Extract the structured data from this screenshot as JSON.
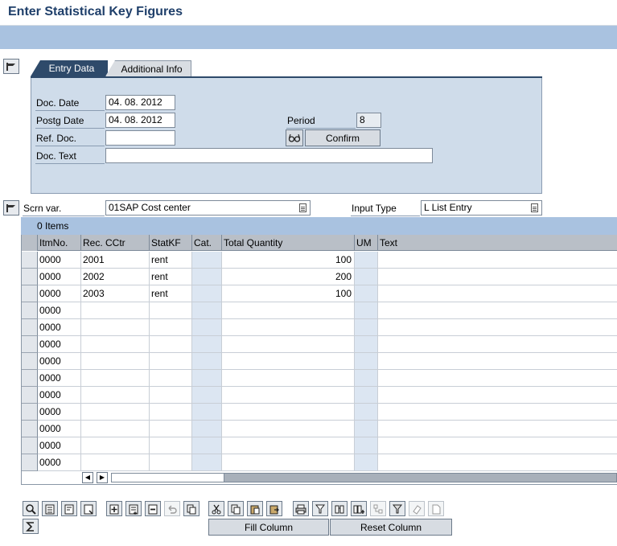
{
  "header": {
    "title": "Enter Statistical Key Figures"
  },
  "tabs": [
    {
      "label": "Entry Data",
      "active": true
    },
    {
      "label": "Additional Info",
      "active": false
    }
  ],
  "entry": {
    "doc_date_label": "Doc. Date",
    "doc_date_value": "04. 08. 2012",
    "postg_date_label": "Postg Date",
    "postg_date_value": "04. 08. 2012",
    "ref_doc_label": "Ref. Doc.",
    "ref_doc_value": "",
    "doc_text_label": "Doc. Text",
    "doc_text_value": "",
    "period_label": "Period",
    "period_value": "8",
    "confirm_label": "Confirm"
  },
  "screen": {
    "scrn_var_label": "Scrn var.",
    "scrn_var_value": "01SAP Cost center",
    "input_type_label": "Input Type",
    "input_type_value": "L List Entry"
  },
  "table": {
    "title": "0 Items",
    "columns": [
      "ItmNo.",
      "Rec. CCtr",
      "StatKF",
      "Cat.",
      "Total Quantity",
      "UM",
      "Text"
    ],
    "rows": [
      {
        "itm": "0000",
        "rec": "2001",
        "statkf": "rent",
        "cat": "",
        "qty": "100",
        "um": "",
        "text": ""
      },
      {
        "itm": "0000",
        "rec": "2002",
        "statkf": "rent",
        "cat": "",
        "qty": "200",
        "um": "",
        "text": ""
      },
      {
        "itm": "0000",
        "rec": "2003",
        "statkf": "rent",
        "cat": "",
        "qty": "100",
        "um": "",
        "text": ""
      },
      {
        "itm": "0000",
        "rec": "",
        "statkf": "",
        "cat": "",
        "qty": "",
        "um": "",
        "text": ""
      },
      {
        "itm": "0000",
        "rec": "",
        "statkf": "",
        "cat": "",
        "qty": "",
        "um": "",
        "text": ""
      },
      {
        "itm": "0000",
        "rec": "",
        "statkf": "",
        "cat": "",
        "qty": "",
        "um": "",
        "text": ""
      },
      {
        "itm": "0000",
        "rec": "",
        "statkf": "",
        "cat": "",
        "qty": "",
        "um": "",
        "text": ""
      },
      {
        "itm": "0000",
        "rec": "",
        "statkf": "",
        "cat": "",
        "qty": "",
        "um": "",
        "text": ""
      },
      {
        "itm": "0000",
        "rec": "",
        "statkf": "",
        "cat": "",
        "qty": "",
        "um": "",
        "text": ""
      },
      {
        "itm": "0000",
        "rec": "",
        "statkf": "",
        "cat": "",
        "qty": "",
        "um": "",
        "text": ""
      },
      {
        "itm": "0000",
        "rec": "",
        "statkf": "",
        "cat": "",
        "qty": "",
        "um": "",
        "text": ""
      },
      {
        "itm": "0000",
        "rec": "",
        "statkf": "",
        "cat": "",
        "qty": "",
        "um": "",
        "text": ""
      },
      {
        "itm": "0000",
        "rec": "",
        "statkf": "",
        "cat": "",
        "qty": "",
        "um": "",
        "text": ""
      }
    ]
  },
  "toolbar": {
    "icons": [
      "details-icon",
      "select-all-icon",
      "deselect-all-icon",
      "select-block-icon",
      "insert-row-icon",
      "append-row-icon",
      "delete-row-icon",
      "undo-icon",
      "copy-row-icon",
      "cut-icon",
      "copy-icon",
      "paste-icon",
      "paste-append-icon",
      "print-icon",
      "filter-column-icon",
      "find-icon",
      "find-next-icon",
      "tree-icon",
      "filter-icon",
      "eraser-icon",
      "page-icon"
    ],
    "sum_icon": "sum-icon",
    "fill_column_label": "Fill Column",
    "reset_column_label": "Reset Column"
  },
  "colors": {
    "title": "#1f3f6a",
    "toolbar_band": "#a9c2e0",
    "panel": "#cfdcea",
    "active_tab": "#2e4a6a"
  }
}
